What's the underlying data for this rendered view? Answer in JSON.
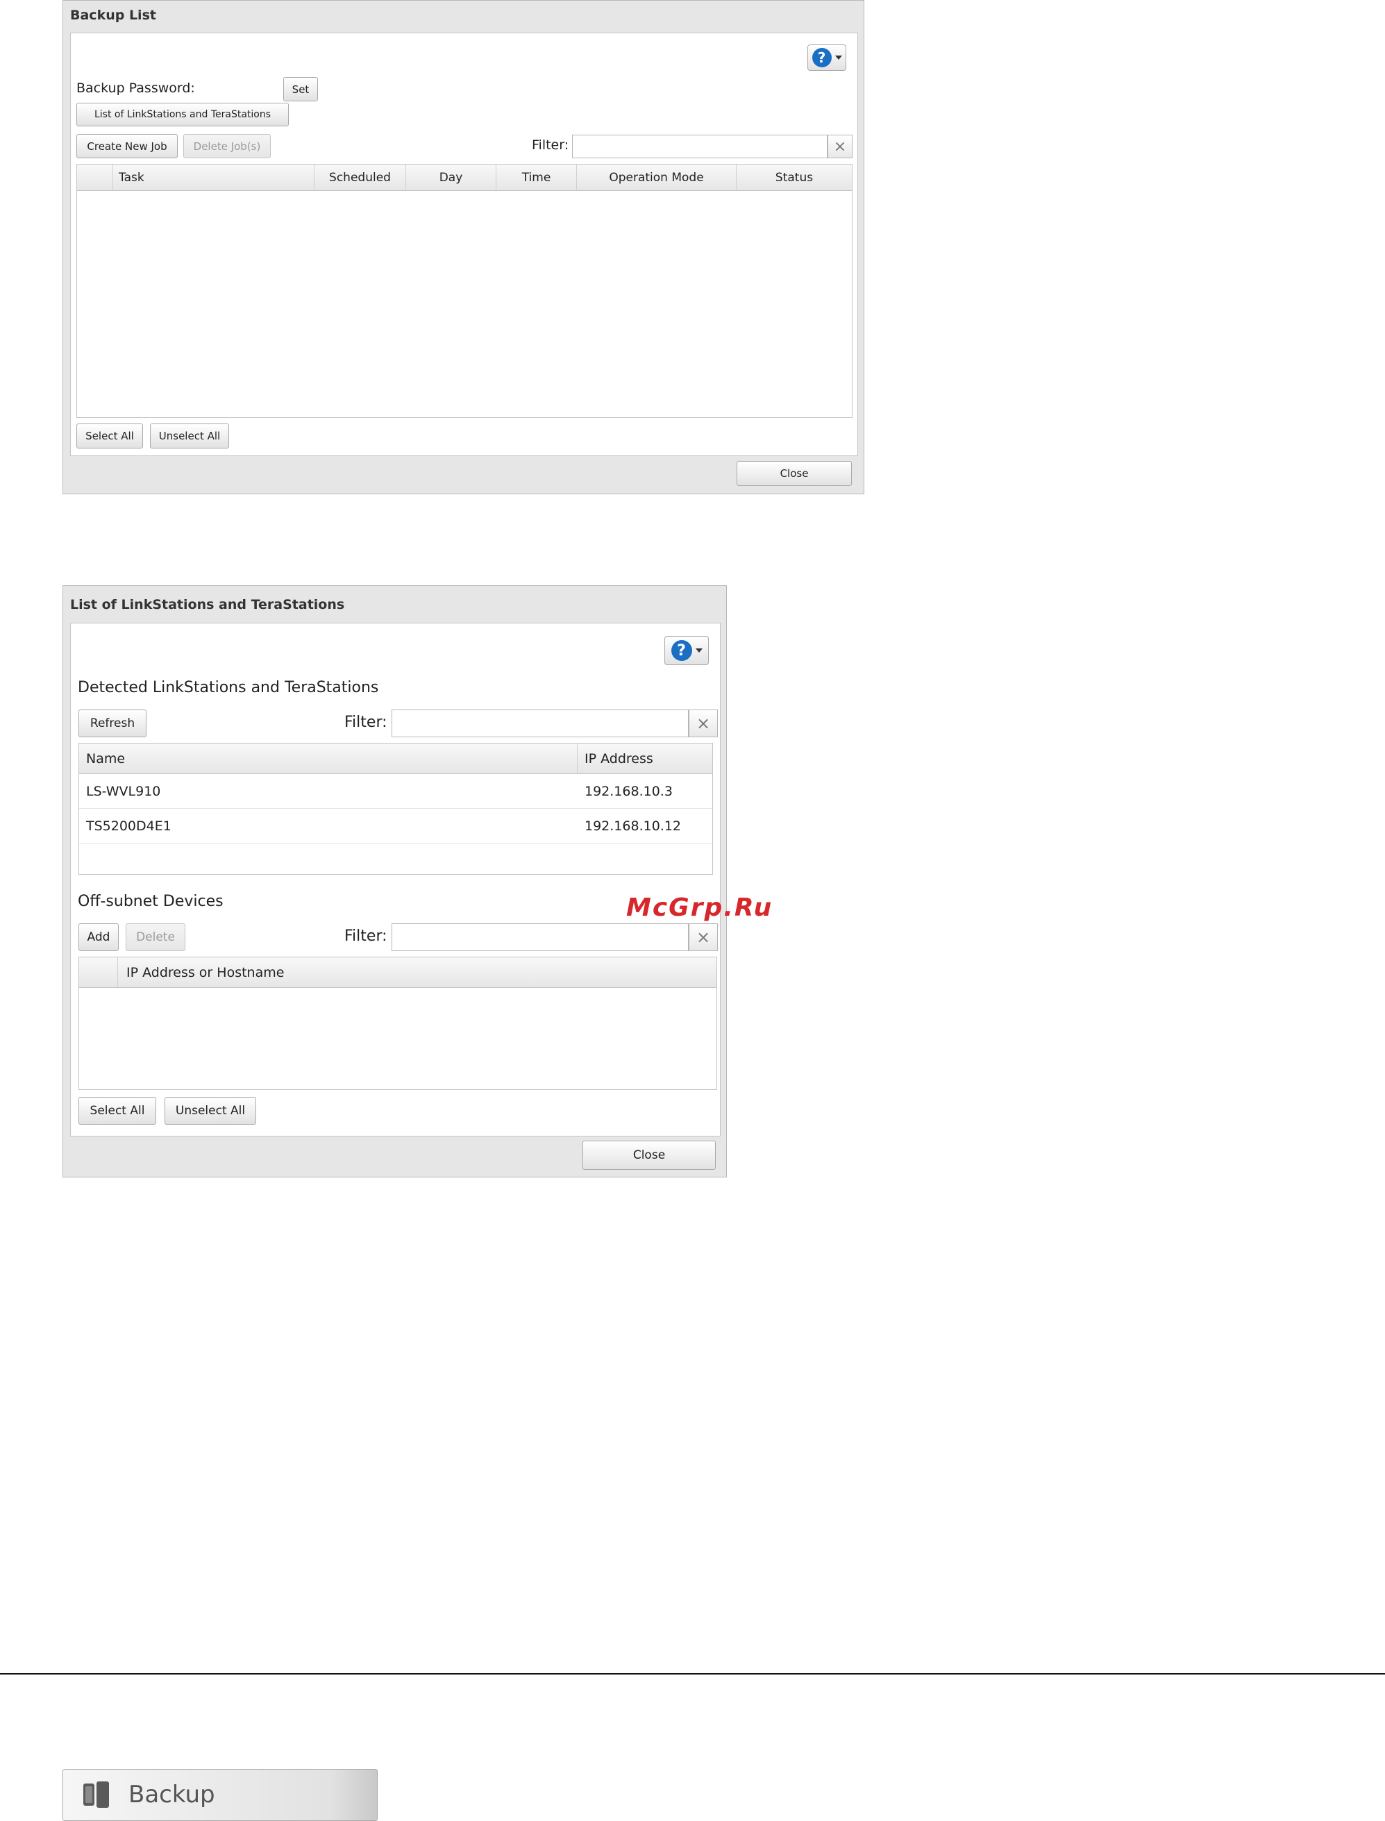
{
  "backup_list": {
    "title": "Backup List",
    "backup_password_label": "Backup Password:",
    "set_label": "Set",
    "list_button_label": "List of LinkStations and TeraStations",
    "create_job_label": "Create New Job",
    "delete_jobs_label": "Delete Job(s)",
    "filter_label": "Filter:",
    "filter_value": "",
    "clear_symbol": "×",
    "help_symbol": "?",
    "columns": [
      "Task",
      "Scheduled",
      "Day",
      "Time",
      "Operation Mode",
      "Status"
    ],
    "select_all_label": "Select All",
    "unselect_all_label": "Unselect All",
    "close_label": "Close"
  },
  "stations": {
    "title": "List of LinkStations and TeraStations",
    "help_symbol": "?",
    "detected_heading": "Detected LinkStations and TeraStations",
    "refresh_label": "Refresh",
    "filter_label": "Filter:",
    "filter_value": "",
    "clear_symbol": "×",
    "columns": [
      "Name",
      "IP Address"
    ],
    "rows": [
      {
        "name": "LS-WVL910",
        "ip": "192.168.10.3"
      },
      {
        "name": "TS5200D4E1",
        "ip": "192.168.10.12"
      }
    ],
    "offsubnet_heading": "Off-subnet Devices",
    "add_label": "Add",
    "delete_label": "Delete",
    "filter2_label": "Filter:",
    "filter2_value": "",
    "offsubnet_column": "IP Address or Hostname",
    "select_all_label": "Select All",
    "unselect_all_label": "Unselect All",
    "close_label": "Close"
  },
  "watermark": "McGrp.Ru",
  "backup_tab": {
    "label": "Backup",
    "icon": "backup-icon"
  },
  "colors": {
    "help_blue": "#1a6fc4",
    "watermark_red": "#d6282a"
  }
}
